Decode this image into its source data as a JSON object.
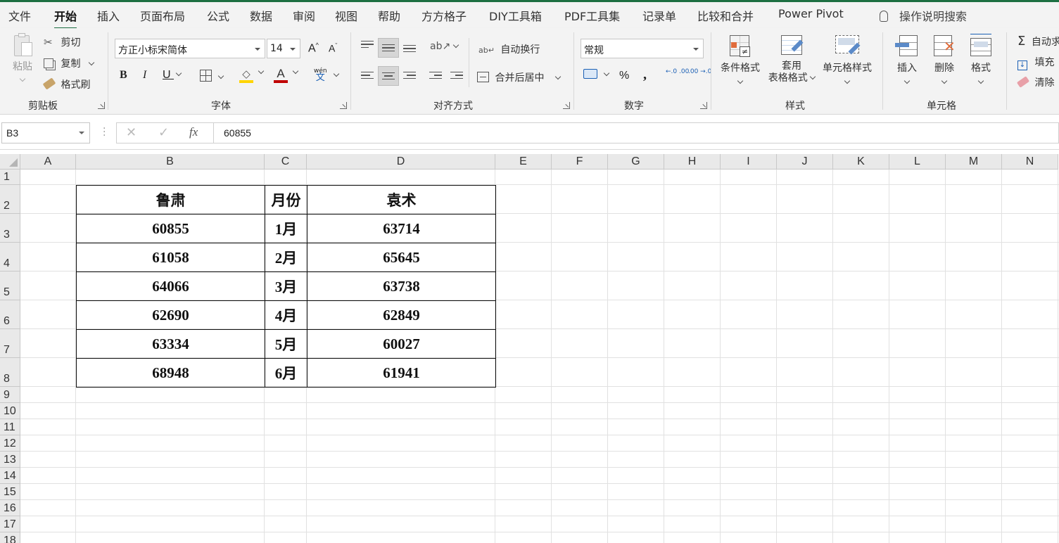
{
  "tabs": [
    "文件",
    "开始",
    "插入",
    "页面布局",
    "公式",
    "数据",
    "审阅",
    "视图",
    "帮助",
    "方方格子",
    "DIY工具箱",
    "PDF工具集",
    "记录单",
    "比较和合并",
    "Power Pivot"
  ],
  "active_tab": "开始",
  "tell_me": "操作说明搜索",
  "clipboard": {
    "paste": "粘贴",
    "cut": "剪切",
    "copy": "复制",
    "format_painter": "格式刷",
    "group": "剪贴板"
  },
  "font": {
    "name": "方正小标宋简体",
    "size": "14",
    "grow": "A",
    "shrink": "A",
    "bold": "B",
    "italic": "I",
    "underline": "U",
    "font_color_letter": "A",
    "phonetic": "wén",
    "group": "字体"
  },
  "alignment": {
    "wrap_text": "自动换行",
    "merge_center": "合并后居中",
    "group": "对齐方式"
  },
  "number": {
    "format": "常规",
    "percent": "%",
    "comma": ",",
    "inc_decimal": "←.0 .00",
    "dec_decimal": ".00 →.0",
    "group": "数字"
  },
  "styles": {
    "conditional": "条件格式",
    "table_format_1": "套用",
    "table_format_2": "表格格式",
    "cell_styles": "单元格样式",
    "group": "样式"
  },
  "cells": {
    "insert": "插入",
    "delete": "删除",
    "format": "格式",
    "group": "单元格"
  },
  "editing": {
    "autosum": "自动求",
    "fill": "填充",
    "clear": "清除"
  },
  "formula_bar": {
    "name_box": "B3",
    "fx": "fx",
    "value": "60855"
  },
  "columns": [
    "A",
    "B",
    "C",
    "D",
    "E",
    "F",
    "G",
    "H",
    "I",
    "J",
    "K",
    "L",
    "M",
    "N"
  ],
  "rows": [
    "1",
    "2",
    "3",
    "4",
    "5",
    "6",
    "7",
    "8",
    "9",
    "10",
    "11",
    "12",
    "13",
    "14",
    "15",
    "16",
    "17",
    "18"
  ],
  "table": {
    "headers": [
      "鲁肃",
      "月份",
      "袁术"
    ],
    "rows": [
      [
        "60855",
        "1月",
        "63714"
      ],
      [
        "61058",
        "2月",
        "65645"
      ],
      [
        "64066",
        "3月",
        "63738"
      ],
      [
        "62690",
        "4月",
        "62849"
      ],
      [
        "63334",
        "5月",
        "60027"
      ],
      [
        "68948",
        "6月",
        "61941"
      ]
    ]
  },
  "colors": {
    "accent_green": "#1d6f42",
    "highlight_yellow": "#ffd400",
    "font_red": "#c00000"
  }
}
